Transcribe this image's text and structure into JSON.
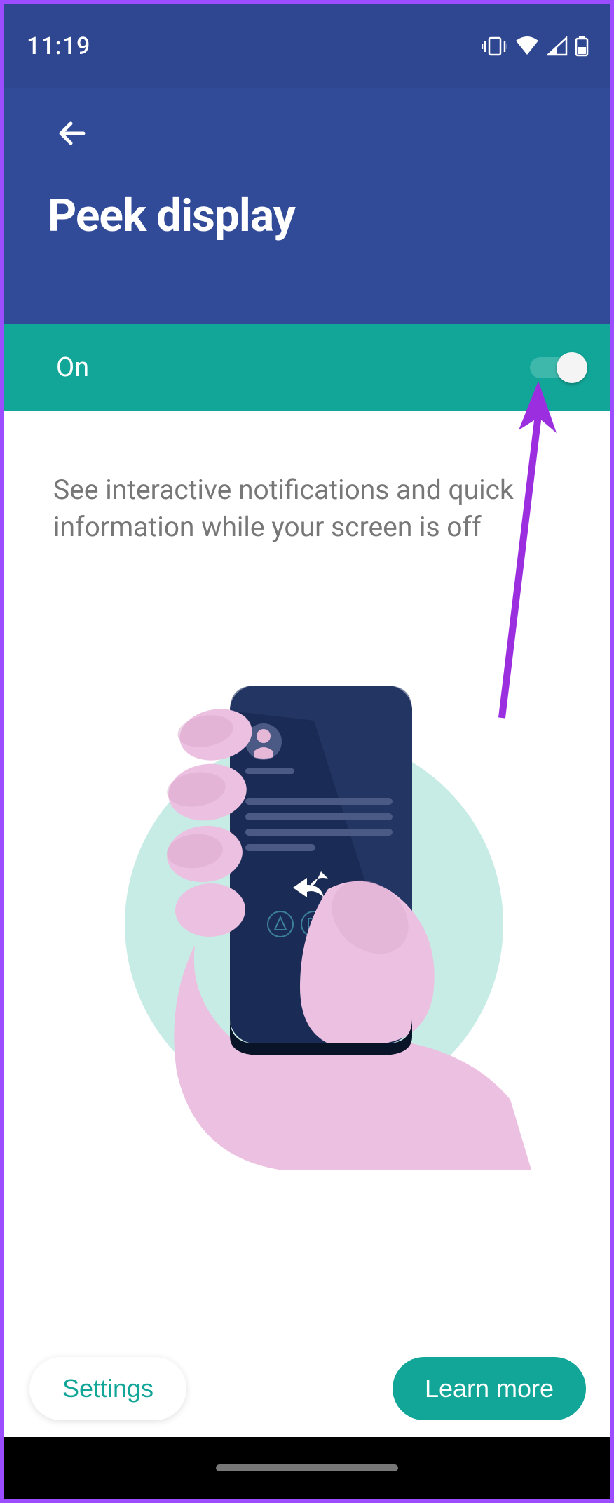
{
  "status": {
    "time": "11:19"
  },
  "header": {
    "title": "Peek display"
  },
  "toggle": {
    "label": "On",
    "state": "on"
  },
  "description": "See interactive notifications and quick information while your screen is off",
  "buttons": {
    "settings": "Settings",
    "learn_more": "Learn more"
  }
}
